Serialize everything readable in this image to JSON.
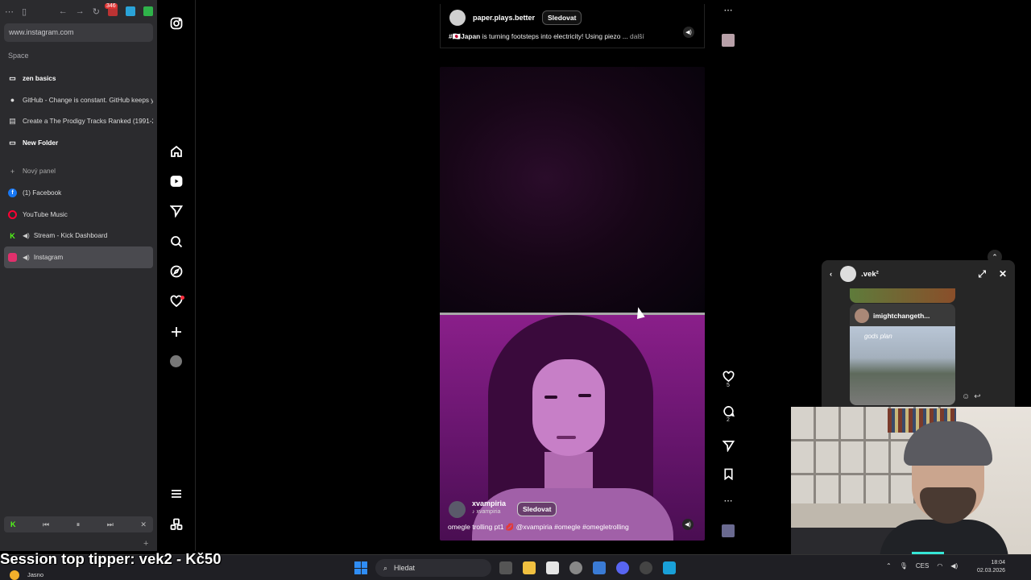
{
  "browser": {
    "url": "www.instagram.com",
    "space_label": "Space",
    "ext_badge": "346",
    "tabs": [
      {
        "label": "zen basics",
        "icon": "folder-icon",
        "bold": true
      },
      {
        "label": "GitHub - Change is constant. GitHub keeps y",
        "icon": "github-icon",
        "bold": false
      },
      {
        "label": "Create a The Prodigy Tracks Ranked (1991-2",
        "icon": "page-icon",
        "bold": false
      },
      {
        "label": "New Folder",
        "icon": "folder-icon",
        "bold": true
      },
      {
        "label": "Nový panel",
        "icon": "plus-icon",
        "bold": false
      },
      {
        "label": "(1) Facebook",
        "icon": "facebook-icon",
        "bold": false
      },
      {
        "label": "YouTube Music",
        "icon": "youtube-music-icon",
        "bold": false
      },
      {
        "label": "Stream - Kick Dashboard",
        "icon": "kick-icon",
        "bold": false
      },
      {
        "label": "Instagram",
        "icon": "instagram-icon",
        "bold": false
      }
    ]
  },
  "feed": {
    "post1": {
      "username": "paper.plays.better",
      "follow_label": "Sledovat",
      "caption_prefix": "#🇯🇵Japan",
      "caption_text": " is turning footsteps into electricity! Using piezo ...",
      "more_label": " další"
    },
    "post2": {
      "username": "xvampiria",
      "sub_username": "xvampiria",
      "follow_label": "Sledovat",
      "caption": "omegle trolling pt1 💋 @xvampiria #omegle #omegletrolling",
      "likes": "5",
      "comments": "2"
    }
  },
  "dm": {
    "title": ".vek²",
    "card_username": "imightchangeth...",
    "card_caption": "gods plan"
  },
  "overlay": {
    "tipper_text": "Session top tipper: vek2 - Kč50"
  },
  "taskbar": {
    "weather": "Jasno",
    "search_placeholder": "Hledat",
    "lang": "CES",
    "time": "18:04",
    "date": "02.03.2026"
  },
  "colors": {
    "instagram_bg": "#000000",
    "sidebar_bg": "#2b2b2e",
    "notification": "#ff3040",
    "kick_green": "#53fc18"
  }
}
